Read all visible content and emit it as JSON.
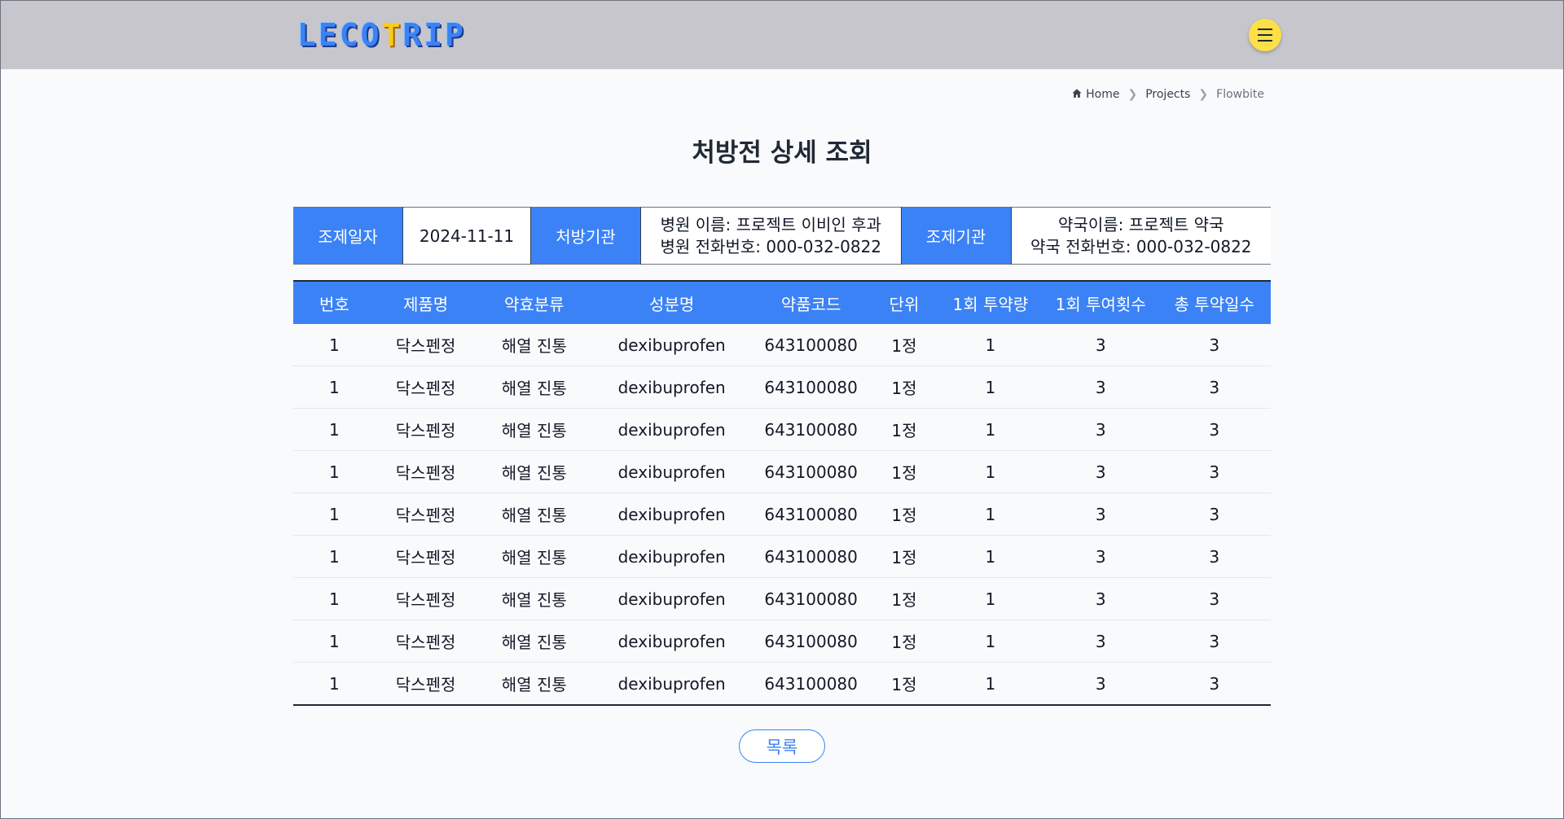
{
  "header": {
    "logo_left": "LECO",
    "logo_accent": "T",
    "logo_right": "RIP"
  },
  "breadcrumb": [
    {
      "label": "Home",
      "icon": "home-icon"
    },
    {
      "label": "Projects"
    },
    {
      "label": "Flowbite"
    }
  ],
  "page_title": "처방전 상세 조회",
  "info": {
    "date_label": "조제일자",
    "date_value": "2024-11-11",
    "hospital_label": "처방기관",
    "hospital_name": "병원 이름: 프로젝트 이비인 후과",
    "hospital_phone": "병원 전화번호: 000-032-0822",
    "pharmacy_label": "조제기관",
    "pharmacy_name": "약국이름: 프로젝트 약국",
    "pharmacy_phone": "약국 전화번호: 000-032-0822"
  },
  "table": {
    "columns": [
      "번호",
      "제품명",
      "약효분류",
      "성분명",
      "약품코드",
      "단위",
      "1회 투약량",
      "1회 투여횟수",
      "총 투약일수"
    ],
    "rows": [
      [
        "1",
        "닥스펜정",
        "해열 진통",
        "dexibuprofen",
        "643100080",
        "1정",
        "1",
        "3",
        "3"
      ],
      [
        "1",
        "닥스펜정",
        "해열 진통",
        "dexibuprofen",
        "643100080",
        "1정",
        "1",
        "3",
        "3"
      ],
      [
        "1",
        "닥스펜정",
        "해열 진통",
        "dexibuprofen",
        "643100080",
        "1정",
        "1",
        "3",
        "3"
      ],
      [
        "1",
        "닥스펜정",
        "해열 진통",
        "dexibuprofen",
        "643100080",
        "1정",
        "1",
        "3",
        "3"
      ],
      [
        "1",
        "닥스펜정",
        "해열 진통",
        "dexibuprofen",
        "643100080",
        "1정",
        "1",
        "3",
        "3"
      ],
      [
        "1",
        "닥스펜정",
        "해열 진통",
        "dexibuprofen",
        "643100080",
        "1정",
        "1",
        "3",
        "3"
      ],
      [
        "1",
        "닥스펜정",
        "해열 진통",
        "dexibuprofen",
        "643100080",
        "1정",
        "1",
        "3",
        "3"
      ],
      [
        "1",
        "닥스펜정",
        "해열 진통",
        "dexibuprofen",
        "643100080",
        "1정",
        "1",
        "3",
        "3"
      ],
      [
        "1",
        "닥스펜정",
        "해열 진통",
        "dexibuprofen",
        "643100080",
        "1정",
        "1",
        "3",
        "3"
      ]
    ]
  },
  "list_button": "목록",
  "colors": {
    "accent": "#3b82f6",
    "navbar": "#c6c6cc",
    "menu_button": "#fde047"
  }
}
